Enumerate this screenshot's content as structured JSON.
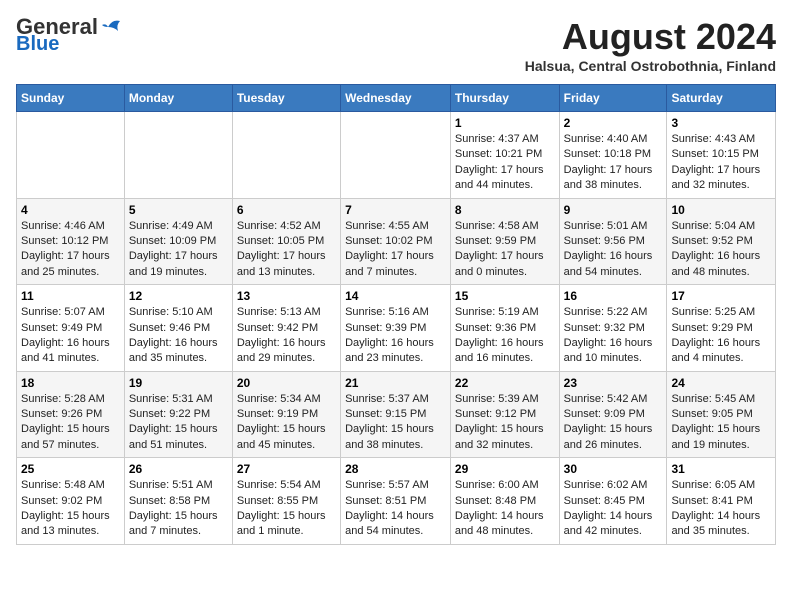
{
  "header": {
    "logo_general": "General",
    "logo_blue": "Blue",
    "month_year": "August 2024",
    "location": "Halsua, Central Ostrobothnia, Finland"
  },
  "days_of_week": [
    "Sunday",
    "Monday",
    "Tuesday",
    "Wednesday",
    "Thursday",
    "Friday",
    "Saturday"
  ],
  "weeks": [
    [
      {
        "day": "",
        "content": ""
      },
      {
        "day": "",
        "content": ""
      },
      {
        "day": "",
        "content": ""
      },
      {
        "day": "",
        "content": ""
      },
      {
        "day": "1",
        "content": "Sunrise: 4:37 AM\nSunset: 10:21 PM\nDaylight: 17 hours and 44 minutes."
      },
      {
        "day": "2",
        "content": "Sunrise: 4:40 AM\nSunset: 10:18 PM\nDaylight: 17 hours and 38 minutes."
      },
      {
        "day": "3",
        "content": "Sunrise: 4:43 AM\nSunset: 10:15 PM\nDaylight: 17 hours and 32 minutes."
      }
    ],
    [
      {
        "day": "4",
        "content": "Sunrise: 4:46 AM\nSunset: 10:12 PM\nDaylight: 17 hours and 25 minutes."
      },
      {
        "day": "5",
        "content": "Sunrise: 4:49 AM\nSunset: 10:09 PM\nDaylight: 17 hours and 19 minutes."
      },
      {
        "day": "6",
        "content": "Sunrise: 4:52 AM\nSunset: 10:05 PM\nDaylight: 17 hours and 13 minutes."
      },
      {
        "day": "7",
        "content": "Sunrise: 4:55 AM\nSunset: 10:02 PM\nDaylight: 17 hours and 7 minutes."
      },
      {
        "day": "8",
        "content": "Sunrise: 4:58 AM\nSunset: 9:59 PM\nDaylight: 17 hours and 0 minutes."
      },
      {
        "day": "9",
        "content": "Sunrise: 5:01 AM\nSunset: 9:56 PM\nDaylight: 16 hours and 54 minutes."
      },
      {
        "day": "10",
        "content": "Sunrise: 5:04 AM\nSunset: 9:52 PM\nDaylight: 16 hours and 48 minutes."
      }
    ],
    [
      {
        "day": "11",
        "content": "Sunrise: 5:07 AM\nSunset: 9:49 PM\nDaylight: 16 hours and 41 minutes."
      },
      {
        "day": "12",
        "content": "Sunrise: 5:10 AM\nSunset: 9:46 PM\nDaylight: 16 hours and 35 minutes."
      },
      {
        "day": "13",
        "content": "Sunrise: 5:13 AM\nSunset: 9:42 PM\nDaylight: 16 hours and 29 minutes."
      },
      {
        "day": "14",
        "content": "Sunrise: 5:16 AM\nSunset: 9:39 PM\nDaylight: 16 hours and 23 minutes."
      },
      {
        "day": "15",
        "content": "Sunrise: 5:19 AM\nSunset: 9:36 PM\nDaylight: 16 hours and 16 minutes."
      },
      {
        "day": "16",
        "content": "Sunrise: 5:22 AM\nSunset: 9:32 PM\nDaylight: 16 hours and 10 minutes."
      },
      {
        "day": "17",
        "content": "Sunrise: 5:25 AM\nSunset: 9:29 PM\nDaylight: 16 hours and 4 minutes."
      }
    ],
    [
      {
        "day": "18",
        "content": "Sunrise: 5:28 AM\nSunset: 9:26 PM\nDaylight: 15 hours and 57 minutes."
      },
      {
        "day": "19",
        "content": "Sunrise: 5:31 AM\nSunset: 9:22 PM\nDaylight: 15 hours and 51 minutes."
      },
      {
        "day": "20",
        "content": "Sunrise: 5:34 AM\nSunset: 9:19 PM\nDaylight: 15 hours and 45 minutes."
      },
      {
        "day": "21",
        "content": "Sunrise: 5:37 AM\nSunset: 9:15 PM\nDaylight: 15 hours and 38 minutes."
      },
      {
        "day": "22",
        "content": "Sunrise: 5:39 AM\nSunset: 9:12 PM\nDaylight: 15 hours and 32 minutes."
      },
      {
        "day": "23",
        "content": "Sunrise: 5:42 AM\nSunset: 9:09 PM\nDaylight: 15 hours and 26 minutes."
      },
      {
        "day": "24",
        "content": "Sunrise: 5:45 AM\nSunset: 9:05 PM\nDaylight: 15 hours and 19 minutes."
      }
    ],
    [
      {
        "day": "25",
        "content": "Sunrise: 5:48 AM\nSunset: 9:02 PM\nDaylight: 15 hours and 13 minutes."
      },
      {
        "day": "26",
        "content": "Sunrise: 5:51 AM\nSunset: 8:58 PM\nDaylight: 15 hours and 7 minutes."
      },
      {
        "day": "27",
        "content": "Sunrise: 5:54 AM\nSunset: 8:55 PM\nDaylight: 15 hours and 1 minute."
      },
      {
        "day": "28",
        "content": "Sunrise: 5:57 AM\nSunset: 8:51 PM\nDaylight: 14 hours and 54 minutes."
      },
      {
        "day": "29",
        "content": "Sunrise: 6:00 AM\nSunset: 8:48 PM\nDaylight: 14 hours and 48 minutes."
      },
      {
        "day": "30",
        "content": "Sunrise: 6:02 AM\nSunset: 8:45 PM\nDaylight: 14 hours and 42 minutes."
      },
      {
        "day": "31",
        "content": "Sunrise: 6:05 AM\nSunset: 8:41 PM\nDaylight: 14 hours and 35 minutes."
      }
    ]
  ]
}
